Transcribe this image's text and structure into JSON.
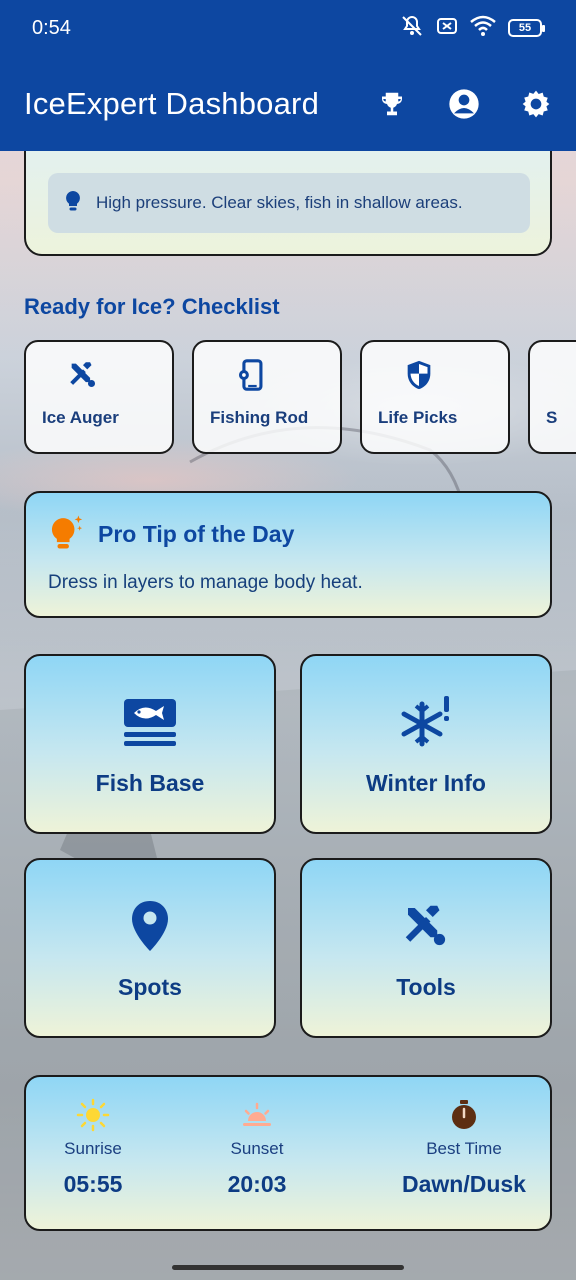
{
  "status_bar": {
    "time": "0:54",
    "battery": "55",
    "icons": [
      "mute-icon",
      "no-sim-icon",
      "wifi-icon",
      "battery-icon"
    ]
  },
  "app_bar": {
    "title": "IceExpert Dashboard",
    "actions": [
      "trophy-icon",
      "account-icon",
      "gear-icon"
    ],
    "color": "#0d47a1"
  },
  "weather": {
    "tip": "High pressure. Clear skies, fish in shallow areas."
  },
  "checklist": {
    "title": "Ready for Ice? Checklist",
    "items": [
      {
        "label": "Ice Auger",
        "icon": "tools-icon"
      },
      {
        "label": "Fishing Rod",
        "icon": "phone-settings-icon"
      },
      {
        "label": "Life Picks",
        "icon": "shield-icon"
      },
      {
        "label": "S",
        "icon": ""
      }
    ]
  },
  "pro_tip": {
    "title": "Pro Tip of the Day",
    "text": "Dress in layers to manage body heat.",
    "icon": "lightbulb-icon"
  },
  "tiles": [
    {
      "label": "Fish Base",
      "icon": "fish-icon"
    },
    {
      "label": "Winter Info",
      "icon": "snowflake-alert-icon"
    },
    {
      "label": "Spots",
      "icon": "location-pin-icon"
    },
    {
      "label": "Tools",
      "icon": "tools-icon"
    }
  ],
  "sun_times": {
    "sunrise_label": "Sunrise",
    "sunrise_value": "05:55",
    "sunset_label": "Sunset",
    "sunset_value": "20:03",
    "best_label": "Best Time",
    "best_value": "Dawn/Dusk"
  }
}
